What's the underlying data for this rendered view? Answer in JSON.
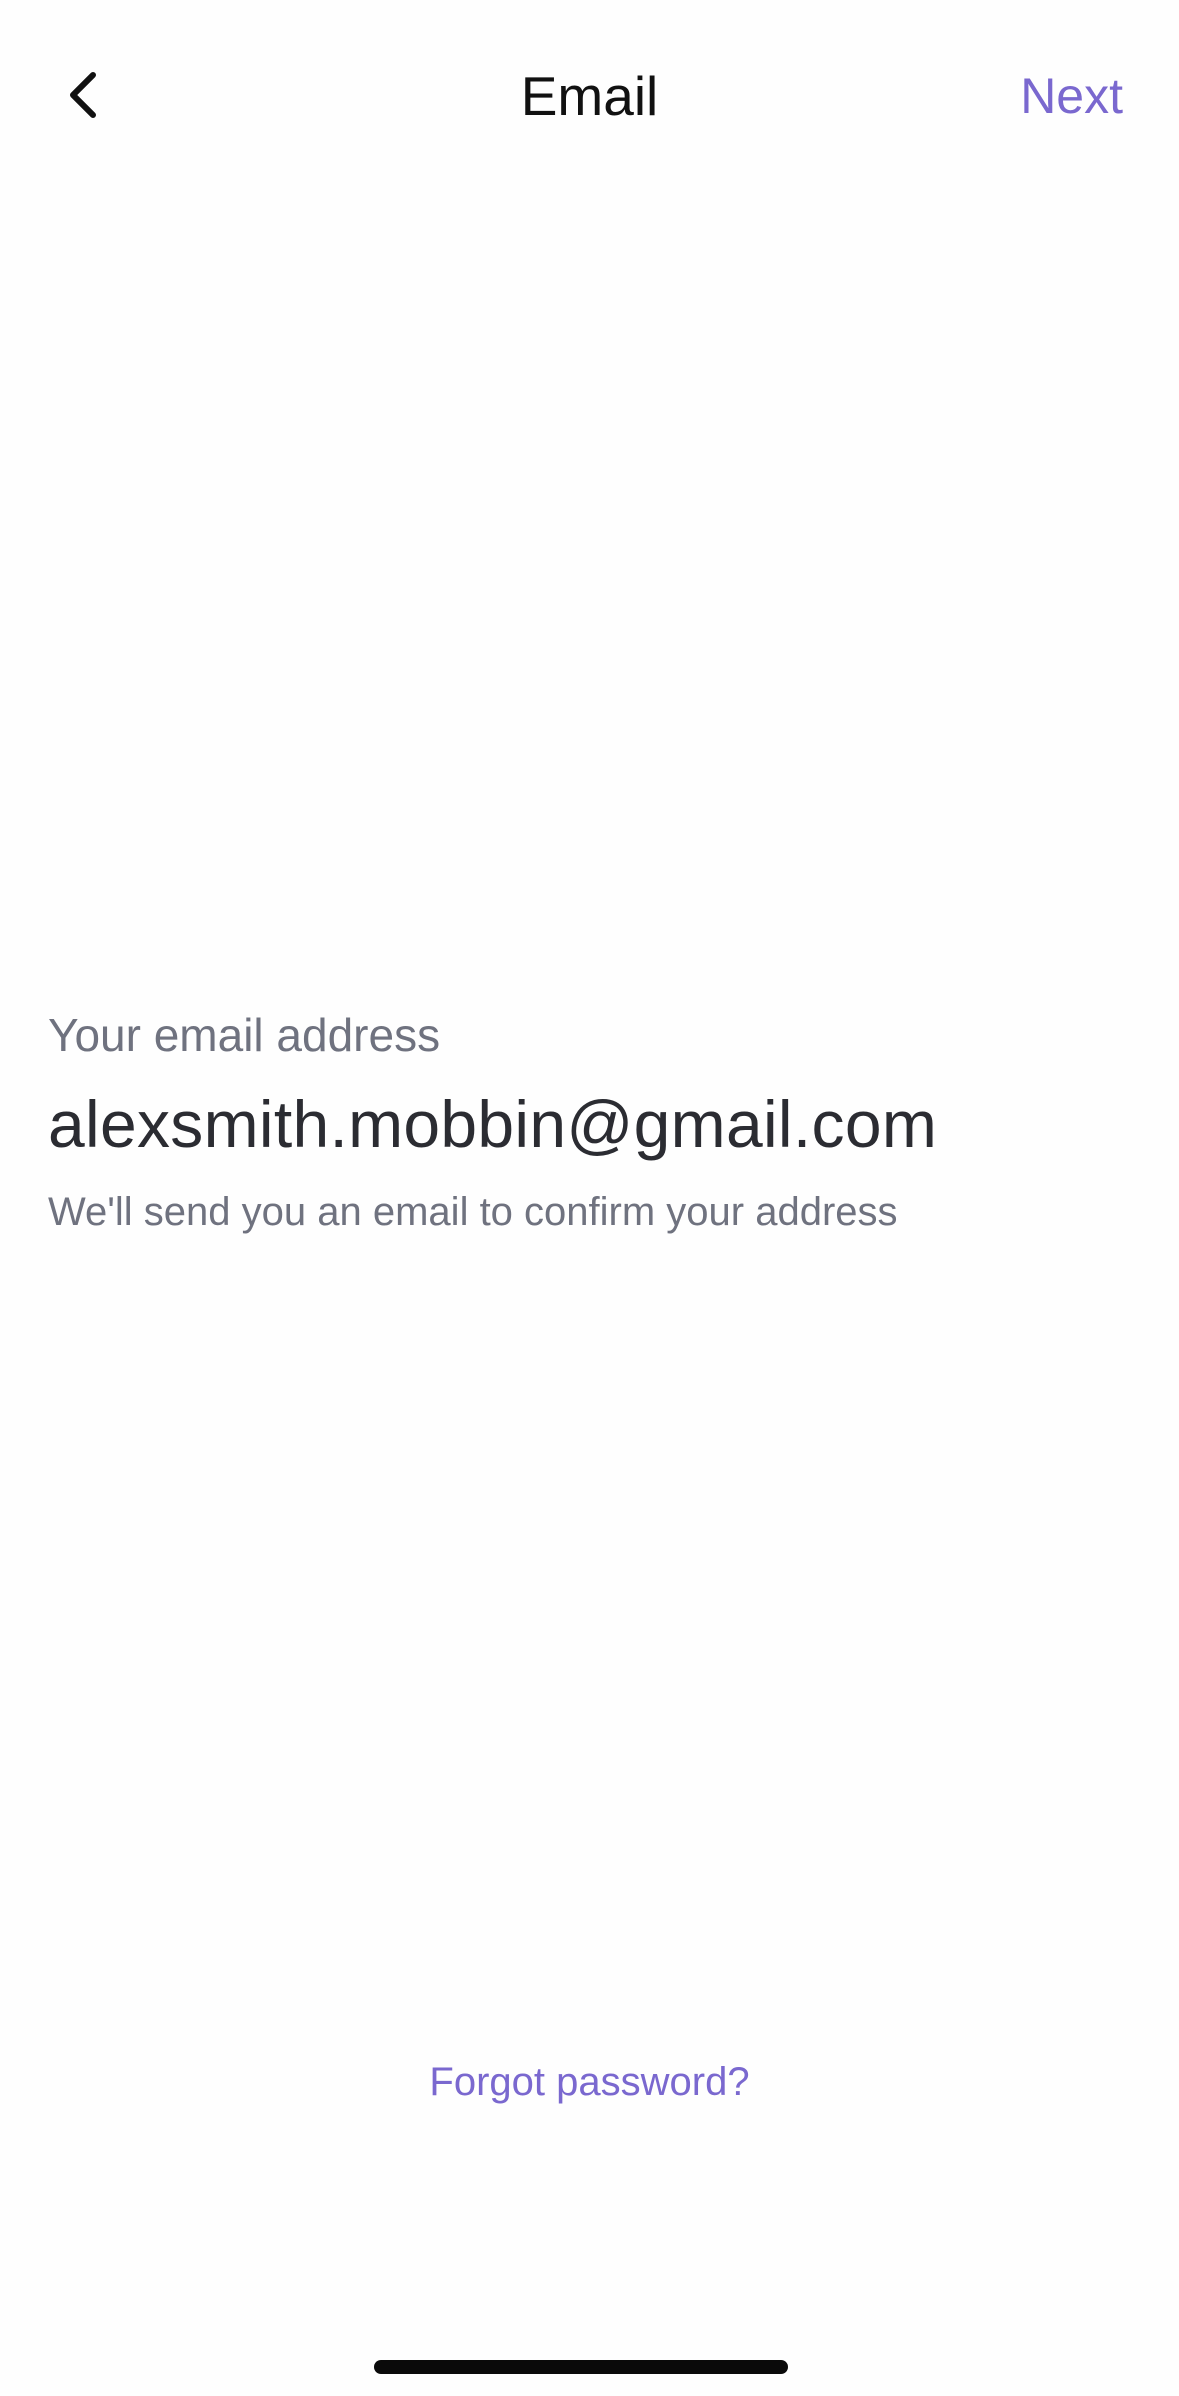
{
  "header": {
    "title": "Email",
    "back_icon": "chevron-left-icon",
    "next_label": "Next",
    "accent_color": "#7a68cf"
  },
  "email": {
    "label": "Your email address",
    "value": "alexsmith.mobbin@gmail.com",
    "hint": "We'll send you an email to confirm your address"
  },
  "footer": {
    "forgot_password_label": "Forgot password?"
  }
}
